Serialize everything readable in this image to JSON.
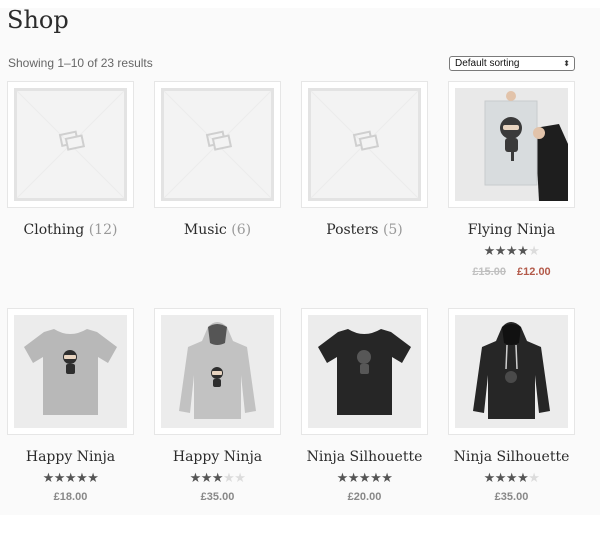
{
  "title": "Shop",
  "result_count": "Showing 1–10 of 23 results",
  "sorting": {
    "selected": "Default sorting"
  },
  "categories": [
    {
      "name": "Clothing",
      "count": "(12)",
      "icon": "image-placeholder-icon"
    },
    {
      "name": "Music",
      "count": "(6)",
      "icon": "image-placeholder-icon"
    },
    {
      "name": "Posters",
      "count": "(5)",
      "icon": "image-placeholder-icon"
    }
  ],
  "products": [
    {
      "name": "Flying Ninja",
      "rating": 4,
      "rating_max": 5,
      "regular_price": "£15.00",
      "sale_price": "£12.00",
      "image": "poster-ninja"
    },
    {
      "name": "Happy Ninja",
      "rating": 5,
      "rating_max": 5,
      "price": "£18.00",
      "image": "grey-tshirt"
    },
    {
      "name": "Happy Ninja",
      "rating": 3,
      "rating_max": 5,
      "price": "£35.00",
      "image": "grey-hoodie"
    },
    {
      "name": "Ninja Silhouette",
      "rating": 5,
      "rating_max": 5,
      "price": "£20.00",
      "image": "black-tshirt"
    },
    {
      "name": "Ninja Silhouette",
      "rating": 4,
      "rating_max": 5,
      "price": "£35.00",
      "image": "black-hoodie"
    }
  ],
  "colors": {
    "sale_price": "#b35a4a",
    "star": "#555555",
    "star_empty": "#dcdcdc"
  }
}
